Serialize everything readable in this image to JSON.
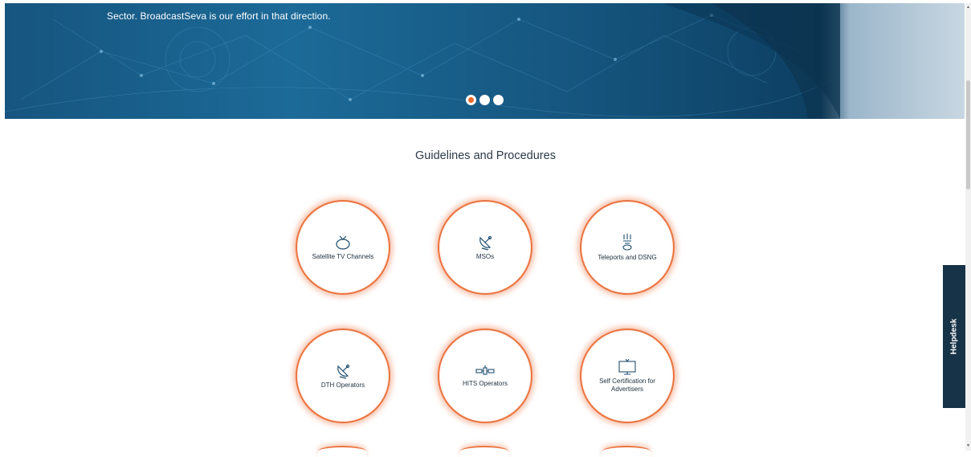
{
  "banner": {
    "text": "Sector. BroadcastSeva is our effort in that direction.",
    "slides": 3,
    "active_slide": 1
  },
  "main": {
    "title": "Guidelines and Procedures",
    "cards": [
      {
        "label": "Satellite TV Channels",
        "icon": "tv-icon"
      },
      {
        "label": "MSOs",
        "icon": "satellite-dish-icon"
      },
      {
        "label": "Teleports and DSNG",
        "icon": "teleport-antenna-icon"
      },
      {
        "label": "DTH Operators",
        "icon": "satellite-dish-icon"
      },
      {
        "label": "HITS Operators",
        "icon": "satellite-icon"
      },
      {
        "label": "Self Certification for Advertisers",
        "icon": "monitor-icon"
      }
    ]
  },
  "helpdesk": {
    "label": "Helpdesk"
  },
  "colors": {
    "accent": "#ea7440",
    "banner": "#16557f",
    "helpdesk": "#173347"
  }
}
